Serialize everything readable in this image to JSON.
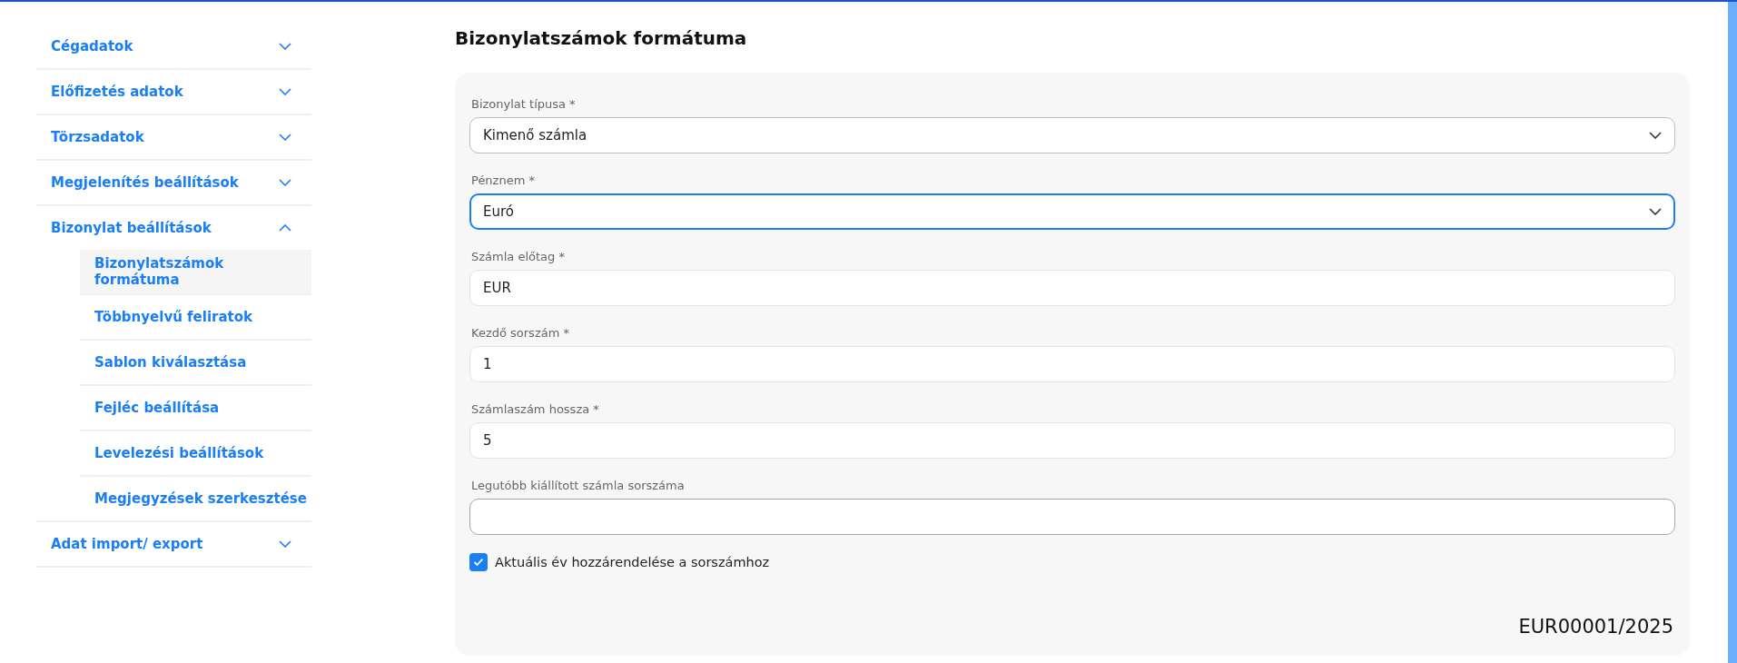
{
  "sidebar": {
    "items": [
      {
        "label": "Cégadatok",
        "expanded": false
      },
      {
        "label": "Előfizetés adatok",
        "expanded": false
      },
      {
        "label": "Törzsadatok",
        "expanded": false
      },
      {
        "label": "Megjelenítés beállítások",
        "expanded": false
      },
      {
        "label": "Bizonylat beállítások",
        "expanded": true,
        "children": [
          {
            "label": "Bizonylatszámok formátuma",
            "selected": true
          },
          {
            "label": "Többnyelvű feliratok",
            "selected": false
          },
          {
            "label": "Sablon kiválasztása",
            "selected": false
          },
          {
            "label": "Fejléc beállítása",
            "selected": false
          },
          {
            "label": "Levelezési beállítások",
            "selected": false
          },
          {
            "label": "Megjegyzések szerkesztése",
            "selected": false
          }
        ]
      },
      {
        "label": "Adat import/ export",
        "expanded": false
      }
    ]
  },
  "page": {
    "title": "Bizonylatszámok formátuma"
  },
  "form": {
    "fields": [
      {
        "kind": "select",
        "label": "Bizonylat típusa *",
        "value": "Kimenő számla",
        "focused": false
      },
      {
        "kind": "select",
        "label": "Pénznem *",
        "value": "Euró",
        "focused": true
      },
      {
        "kind": "text",
        "label": "Számla előtag *",
        "value": "EUR",
        "focused": false
      },
      {
        "kind": "text",
        "label": "Kezdő sorszám *",
        "value": "1",
        "focused": false
      },
      {
        "kind": "text",
        "label": "Számlaszám hossza *",
        "value": "5",
        "focused": false
      },
      {
        "kind": "text",
        "label": "Legutóbb kiállított számla sorszáma",
        "focused": false
      }
    ],
    "checkbox": {
      "label": "Aktuális év hozzárendelése a sorszámhoz",
      "checked": true
    },
    "preview": "EUR00001/2025"
  }
}
